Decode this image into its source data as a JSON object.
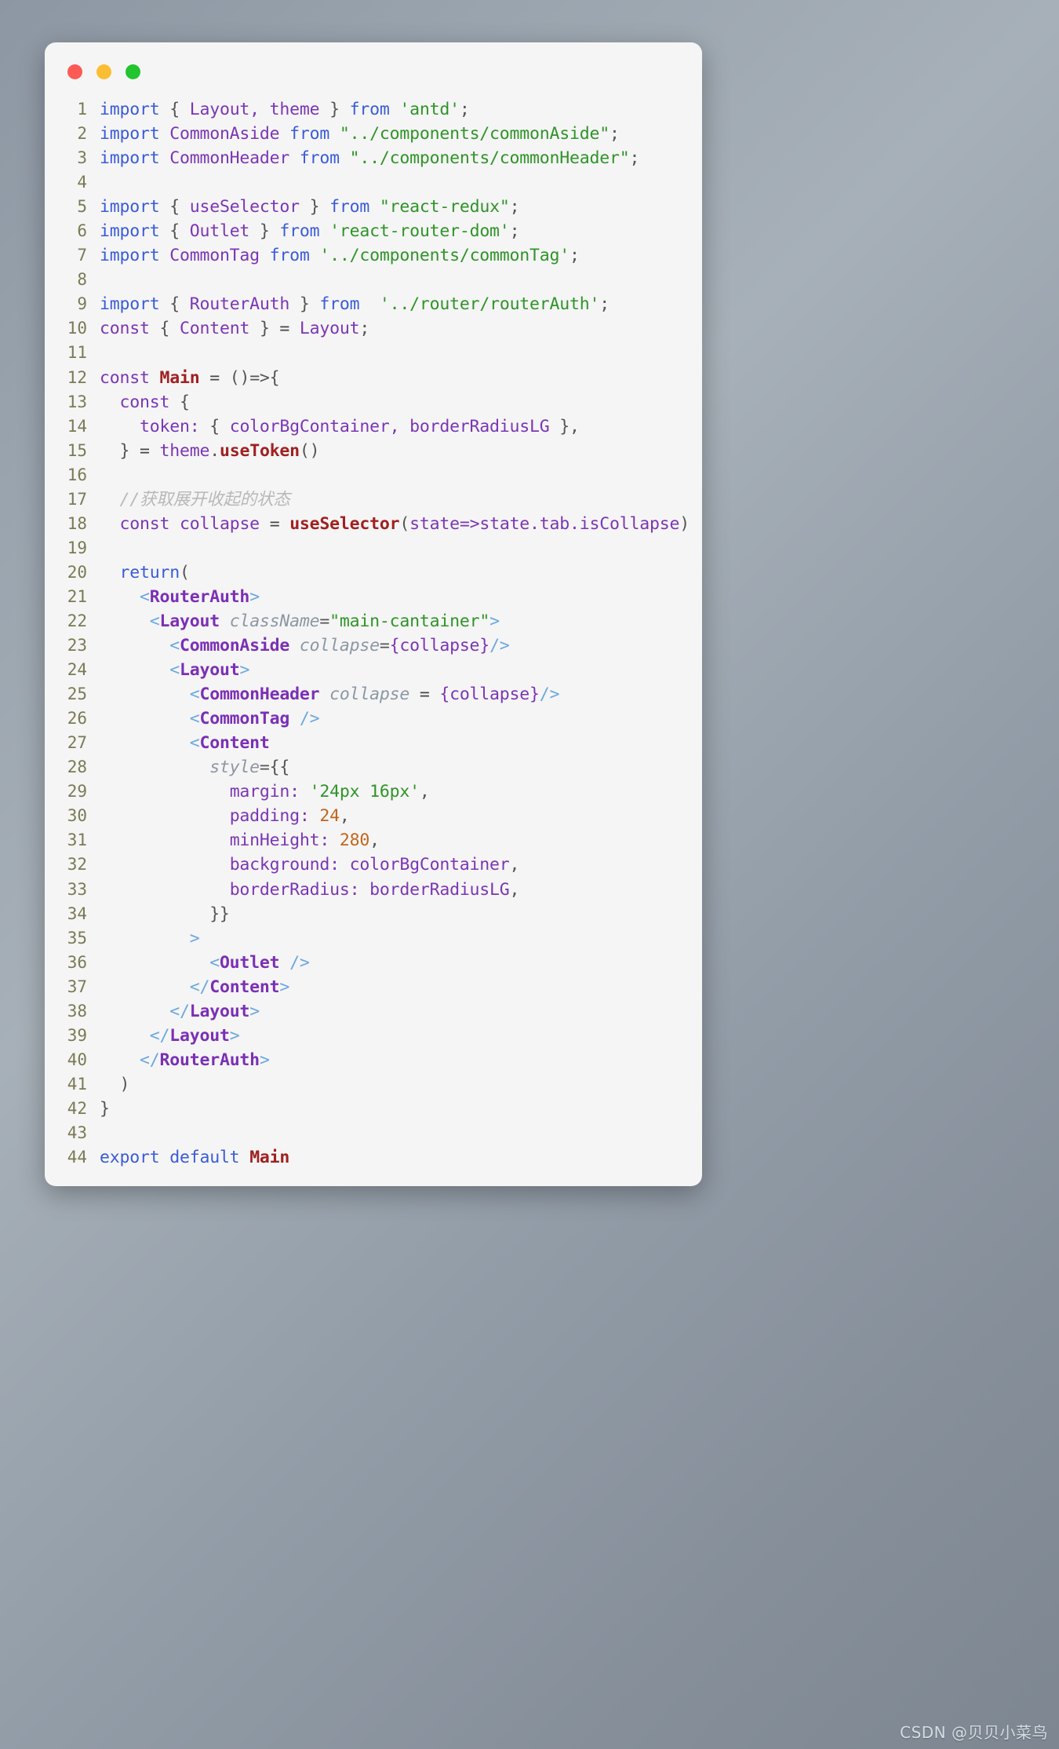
{
  "window": {
    "traffic_lights": [
      {
        "name": "close",
        "color": "#fb5a55"
      },
      {
        "name": "minimize",
        "color": "#fbbe33"
      },
      {
        "name": "maximize",
        "color": "#22c530"
      }
    ]
  },
  "watermark": "CSDN @贝贝小菜鸟",
  "editor": {
    "language": "jsx",
    "total_lines": 44,
    "lines": [
      {
        "n": "1",
        "tokens": [
          {
            "t": "import",
            "c": "kw"
          },
          {
            "t": " ",
            "c": "plain"
          },
          {
            "t": "{",
            "c": "punct"
          },
          {
            "t": " Layout, theme ",
            "c": "ident"
          },
          {
            "t": "}",
            "c": "punct"
          },
          {
            "t": " ",
            "c": "plain"
          },
          {
            "t": "from",
            "c": "kw"
          },
          {
            "t": " ",
            "c": "plain"
          },
          {
            "t": "'antd'",
            "c": "str"
          },
          {
            "t": ";",
            "c": "punct"
          }
        ]
      },
      {
        "n": "2",
        "tokens": [
          {
            "t": "import",
            "c": "kw"
          },
          {
            "t": " ",
            "c": "plain"
          },
          {
            "t": "CommonAside",
            "c": "ident"
          },
          {
            "t": " ",
            "c": "plain"
          },
          {
            "t": "from",
            "c": "kw"
          },
          {
            "t": " ",
            "c": "plain"
          },
          {
            "t": "\"../components/commonAside\"",
            "c": "str"
          },
          {
            "t": ";",
            "c": "punct"
          }
        ]
      },
      {
        "n": "3",
        "tokens": [
          {
            "t": "import",
            "c": "kw"
          },
          {
            "t": " ",
            "c": "plain"
          },
          {
            "t": "CommonHeader",
            "c": "ident"
          },
          {
            "t": " ",
            "c": "plain"
          },
          {
            "t": "from",
            "c": "kw"
          },
          {
            "t": " ",
            "c": "plain"
          },
          {
            "t": "\"../components/commonHeader\"",
            "c": "str"
          },
          {
            "t": ";",
            "c": "punct"
          }
        ]
      },
      {
        "n": "4",
        "tokens": []
      },
      {
        "n": "5",
        "tokens": [
          {
            "t": "import",
            "c": "kw"
          },
          {
            "t": " ",
            "c": "plain"
          },
          {
            "t": "{",
            "c": "punct"
          },
          {
            "t": " useSelector ",
            "c": "ident"
          },
          {
            "t": "}",
            "c": "punct"
          },
          {
            "t": " ",
            "c": "plain"
          },
          {
            "t": "from",
            "c": "kw"
          },
          {
            "t": " ",
            "c": "plain"
          },
          {
            "t": "\"react-redux\"",
            "c": "str"
          },
          {
            "t": ";",
            "c": "punct"
          }
        ]
      },
      {
        "n": "6",
        "tokens": [
          {
            "t": "import",
            "c": "kw"
          },
          {
            "t": " ",
            "c": "plain"
          },
          {
            "t": "{",
            "c": "punct"
          },
          {
            "t": " Outlet ",
            "c": "ident"
          },
          {
            "t": "}",
            "c": "punct"
          },
          {
            "t": " ",
            "c": "plain"
          },
          {
            "t": "from",
            "c": "kw"
          },
          {
            "t": " ",
            "c": "plain"
          },
          {
            "t": "'react-router-dom'",
            "c": "str"
          },
          {
            "t": ";",
            "c": "punct"
          }
        ]
      },
      {
        "n": "7",
        "tokens": [
          {
            "t": "import",
            "c": "kw"
          },
          {
            "t": " ",
            "c": "plain"
          },
          {
            "t": "CommonTag",
            "c": "ident"
          },
          {
            "t": " ",
            "c": "plain"
          },
          {
            "t": "from",
            "c": "kw"
          },
          {
            "t": " ",
            "c": "plain"
          },
          {
            "t": "'../components/commonTag'",
            "c": "str"
          },
          {
            "t": ";",
            "c": "punct"
          }
        ]
      },
      {
        "n": "8",
        "tokens": []
      },
      {
        "n": "9",
        "tokens": [
          {
            "t": "import",
            "c": "kw"
          },
          {
            "t": " ",
            "c": "plain"
          },
          {
            "t": "{",
            "c": "punct"
          },
          {
            "t": " RouterAuth ",
            "c": "ident"
          },
          {
            "t": "}",
            "c": "punct"
          },
          {
            "t": " ",
            "c": "plain"
          },
          {
            "t": "from",
            "c": "kw"
          },
          {
            "t": "  ",
            "c": "plain"
          },
          {
            "t": "'../router/routerAuth'",
            "c": "str"
          },
          {
            "t": ";",
            "c": "punct"
          }
        ]
      },
      {
        "n": "10",
        "tokens": [
          {
            "t": "const",
            "c": "ident"
          },
          {
            "t": " ",
            "c": "plain"
          },
          {
            "t": "{",
            "c": "punct"
          },
          {
            "t": " Content ",
            "c": "ident"
          },
          {
            "t": "}",
            "c": "punct"
          },
          {
            "t": " = ",
            "c": "plain"
          },
          {
            "t": "Layout",
            "c": "ident"
          },
          {
            "t": ";",
            "c": "punct"
          }
        ]
      },
      {
        "n": "11",
        "tokens": []
      },
      {
        "n": "12",
        "tokens": [
          {
            "t": "const",
            "c": "ident"
          },
          {
            "t": " ",
            "c": "plain"
          },
          {
            "t": "Main",
            "c": "fn"
          },
          {
            "t": " = ",
            "c": "plain"
          },
          {
            "t": "()=>{",
            "c": "punct"
          }
        ]
      },
      {
        "n": "13",
        "tokens": [
          {
            "t": "  ",
            "c": "plain"
          },
          {
            "t": "const",
            "c": "ident"
          },
          {
            "t": " ",
            "c": "plain"
          },
          {
            "t": "{",
            "c": "punct"
          }
        ]
      },
      {
        "n": "14",
        "tokens": [
          {
            "t": "    ",
            "c": "plain"
          },
          {
            "t": "token:",
            "c": "ident"
          },
          {
            "t": " ",
            "c": "plain"
          },
          {
            "t": "{",
            "c": "punct"
          },
          {
            "t": " colorBgContainer, borderRadiusLG ",
            "c": "ident"
          },
          {
            "t": "}",
            "c": "punct"
          },
          {
            "t": ",",
            "c": "punct"
          }
        ]
      },
      {
        "n": "15",
        "tokens": [
          {
            "t": "  ",
            "c": "plain"
          },
          {
            "t": "}",
            "c": "punct"
          },
          {
            "t": " = ",
            "c": "plain"
          },
          {
            "t": "theme",
            "c": "ident"
          },
          {
            "t": ".",
            "c": "punct"
          },
          {
            "t": "useToken",
            "c": "fn"
          },
          {
            "t": "()",
            "c": "punct"
          }
        ]
      },
      {
        "n": "16",
        "tokens": []
      },
      {
        "n": "17",
        "tokens": [
          {
            "t": "  ",
            "c": "plain"
          },
          {
            "t": "//获取展开收起的状态",
            "c": "comment"
          }
        ]
      },
      {
        "n": "18",
        "tokens": [
          {
            "t": "  ",
            "c": "plain"
          },
          {
            "t": "const",
            "c": "ident"
          },
          {
            "t": " collapse ",
            "c": "ident"
          },
          {
            "t": "= ",
            "c": "plain"
          },
          {
            "t": "useSelector",
            "c": "fn"
          },
          {
            "t": "(",
            "c": "punct"
          },
          {
            "t": "state=>state.tab.isCollapse",
            "c": "ident"
          },
          {
            "t": ")",
            "c": "punct"
          }
        ]
      },
      {
        "n": "19",
        "tokens": []
      },
      {
        "n": "20",
        "tokens": [
          {
            "t": "  ",
            "c": "plain"
          },
          {
            "t": "return",
            "c": "kw"
          },
          {
            "t": "(",
            "c": "punct"
          }
        ]
      },
      {
        "n": "21",
        "tokens": [
          {
            "t": "    ",
            "c": "plain"
          },
          {
            "t": "<",
            "c": "bracket"
          },
          {
            "t": "RouterAuth",
            "c": "comp"
          },
          {
            "t": ">",
            "c": "bracket"
          }
        ]
      },
      {
        "n": "22",
        "tokens": [
          {
            "t": "     ",
            "c": "plain"
          },
          {
            "t": "<",
            "c": "bracket"
          },
          {
            "t": "Layout",
            "c": "comp"
          },
          {
            "t": " ",
            "c": "plain"
          },
          {
            "t": "className",
            "c": "attr"
          },
          {
            "t": "=",
            "c": "punct"
          },
          {
            "t": "\"main-cantainer\"",
            "c": "str"
          },
          {
            "t": ">",
            "c": "bracket"
          }
        ]
      },
      {
        "n": "23",
        "tokens": [
          {
            "t": "       ",
            "c": "plain"
          },
          {
            "t": "<",
            "c": "bracket"
          },
          {
            "t": "CommonAside",
            "c": "comp"
          },
          {
            "t": " ",
            "c": "plain"
          },
          {
            "t": "collapse",
            "c": "attr"
          },
          {
            "t": "=",
            "c": "punct"
          },
          {
            "t": "{collapse}",
            "c": "ident"
          },
          {
            "t": "/>",
            "c": "bracket"
          }
        ]
      },
      {
        "n": "24",
        "tokens": [
          {
            "t": "       ",
            "c": "plain"
          },
          {
            "t": "<",
            "c": "bracket"
          },
          {
            "t": "Layout",
            "c": "comp"
          },
          {
            "t": ">",
            "c": "bracket"
          }
        ]
      },
      {
        "n": "25",
        "tokens": [
          {
            "t": "         ",
            "c": "plain"
          },
          {
            "t": "<",
            "c": "bracket"
          },
          {
            "t": "CommonHeader",
            "c": "comp"
          },
          {
            "t": " ",
            "c": "plain"
          },
          {
            "t": "collapse",
            "c": "attr"
          },
          {
            "t": " = ",
            "c": "plain"
          },
          {
            "t": "{collapse}",
            "c": "ident"
          },
          {
            "t": "/>",
            "c": "bracket"
          }
        ]
      },
      {
        "n": "26",
        "tokens": [
          {
            "t": "         ",
            "c": "plain"
          },
          {
            "t": "<",
            "c": "bracket"
          },
          {
            "t": "CommonTag",
            "c": "comp"
          },
          {
            "t": " ",
            "c": "plain"
          },
          {
            "t": "/>",
            "c": "bracket"
          }
        ]
      },
      {
        "n": "27",
        "tokens": [
          {
            "t": "         ",
            "c": "plain"
          },
          {
            "t": "<",
            "c": "bracket"
          },
          {
            "t": "Content",
            "c": "comp"
          }
        ]
      },
      {
        "n": "28",
        "tokens": [
          {
            "t": "           ",
            "c": "plain"
          },
          {
            "t": "style",
            "c": "attr"
          },
          {
            "t": "=",
            "c": "punct"
          },
          {
            "t": "{{",
            "c": "punct"
          }
        ]
      },
      {
        "n": "29",
        "tokens": [
          {
            "t": "             ",
            "c": "plain"
          },
          {
            "t": "margin:",
            "c": "ident"
          },
          {
            "t": " ",
            "c": "plain"
          },
          {
            "t": "'24px 16px'",
            "c": "str"
          },
          {
            "t": ",",
            "c": "punct"
          }
        ]
      },
      {
        "n": "30",
        "tokens": [
          {
            "t": "             ",
            "c": "plain"
          },
          {
            "t": "padding:",
            "c": "ident"
          },
          {
            "t": " ",
            "c": "plain"
          },
          {
            "t": "24",
            "c": "num"
          },
          {
            "t": ",",
            "c": "punct"
          }
        ]
      },
      {
        "n": "31",
        "tokens": [
          {
            "t": "             ",
            "c": "plain"
          },
          {
            "t": "minHeight:",
            "c": "ident"
          },
          {
            "t": " ",
            "c": "plain"
          },
          {
            "t": "280",
            "c": "num"
          },
          {
            "t": ",",
            "c": "punct"
          }
        ]
      },
      {
        "n": "32",
        "tokens": [
          {
            "t": "             ",
            "c": "plain"
          },
          {
            "t": "background:",
            "c": "ident"
          },
          {
            "t": " colorBgContainer",
            "c": "ident"
          },
          {
            "t": ",",
            "c": "punct"
          }
        ]
      },
      {
        "n": "33",
        "tokens": [
          {
            "t": "             ",
            "c": "plain"
          },
          {
            "t": "borderRadius:",
            "c": "ident"
          },
          {
            "t": " borderRadiusLG",
            "c": "ident"
          },
          {
            "t": ",",
            "c": "punct"
          }
        ]
      },
      {
        "n": "34",
        "tokens": [
          {
            "t": "           ",
            "c": "plain"
          },
          {
            "t": "}}",
            "c": "punct"
          }
        ]
      },
      {
        "n": "35",
        "tokens": [
          {
            "t": "         ",
            "c": "plain"
          },
          {
            "t": ">",
            "c": "bracket"
          }
        ]
      },
      {
        "n": "36",
        "tokens": [
          {
            "t": "           ",
            "c": "plain"
          },
          {
            "t": "<",
            "c": "bracket"
          },
          {
            "t": "Outlet",
            "c": "comp"
          },
          {
            "t": " ",
            "c": "plain"
          },
          {
            "t": "/>",
            "c": "bracket"
          }
        ]
      },
      {
        "n": "37",
        "tokens": [
          {
            "t": "         ",
            "c": "plain"
          },
          {
            "t": "</",
            "c": "bracket"
          },
          {
            "t": "Content",
            "c": "comp"
          },
          {
            "t": ">",
            "c": "bracket"
          }
        ]
      },
      {
        "n": "38",
        "tokens": [
          {
            "t": "       ",
            "c": "plain"
          },
          {
            "t": "</",
            "c": "bracket"
          },
          {
            "t": "Layout",
            "c": "comp"
          },
          {
            "t": ">",
            "c": "bracket"
          }
        ]
      },
      {
        "n": "39",
        "tokens": [
          {
            "t": "     ",
            "c": "plain"
          },
          {
            "t": "</",
            "c": "bracket"
          },
          {
            "t": "Layout",
            "c": "comp"
          },
          {
            "t": ">",
            "c": "bracket"
          }
        ]
      },
      {
        "n": "40",
        "tokens": [
          {
            "t": "    ",
            "c": "plain"
          },
          {
            "t": "</",
            "c": "bracket"
          },
          {
            "t": "RouterAuth",
            "c": "comp"
          },
          {
            "t": ">",
            "c": "bracket"
          }
        ]
      },
      {
        "n": "41",
        "tokens": [
          {
            "t": "  ",
            "c": "plain"
          },
          {
            "t": ")",
            "c": "punct"
          }
        ]
      },
      {
        "n": "42",
        "tokens": [
          {
            "t": "}",
            "c": "punct"
          }
        ]
      },
      {
        "n": "43",
        "tokens": []
      },
      {
        "n": "44",
        "tokens": [
          {
            "t": "export",
            "c": "kw"
          },
          {
            "t": " ",
            "c": "plain"
          },
          {
            "t": "default",
            "c": "kw"
          },
          {
            "t": " ",
            "c": "plain"
          },
          {
            "t": "Main",
            "c": "fn"
          }
        ]
      }
    ]
  }
}
